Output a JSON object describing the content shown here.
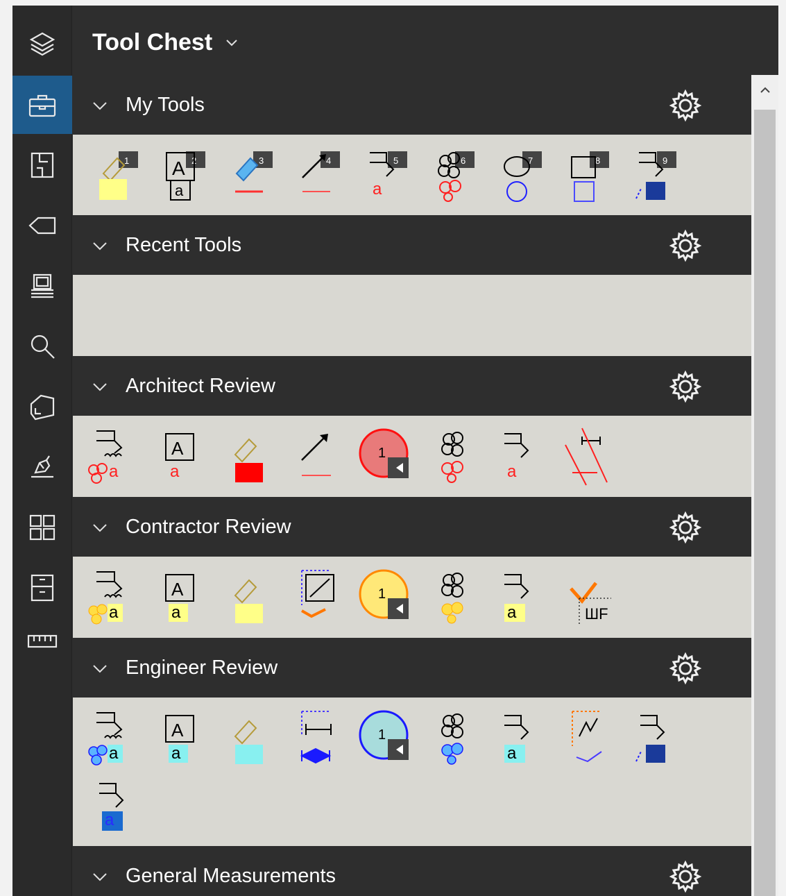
{
  "panel": {
    "title": "Tool Chest"
  },
  "rail": {
    "items": [
      {
        "icon": "layers-icon",
        "active": false
      },
      {
        "icon": "toolbox-icon",
        "active": true
      },
      {
        "icon": "thumbnails-icon",
        "active": false
      },
      {
        "icon": "tag-icon",
        "active": false
      },
      {
        "icon": "properties-icon",
        "active": false
      },
      {
        "icon": "search-icon",
        "active": false
      },
      {
        "icon": "spaces-icon",
        "active": false
      },
      {
        "icon": "signature-icon",
        "active": false
      },
      {
        "icon": "grid-icon",
        "active": false
      },
      {
        "icon": "file-access-icon",
        "active": false
      },
      {
        "icon": "measurements-icon",
        "active": false
      }
    ]
  },
  "sections": [
    {
      "label": "My Tools",
      "badges": [
        "1",
        "2",
        "3",
        "4",
        "5",
        "6",
        "7",
        "8",
        "9"
      ]
    },
    {
      "label": "Recent Tools"
    },
    {
      "label": "Architect Review"
    },
    {
      "label": "Contractor Review"
    },
    {
      "label": "Engineer Review"
    },
    {
      "label": "General Measurements"
    }
  ],
  "tool_glyphs": {
    "text_letter": "a",
    "box_letter": "A",
    "count_digit": "1",
    "tally": "ШF"
  },
  "colors": {
    "accent_active": "#1e5b8c",
    "section_bg": "#d9d8d2",
    "header_bg": "#2e2e2e",
    "markup_red": "#ff2020",
    "markup_yellow": "#ffff88",
    "markup_cyan": "#88f0f0",
    "markup_blue": "#1a1aff"
  }
}
